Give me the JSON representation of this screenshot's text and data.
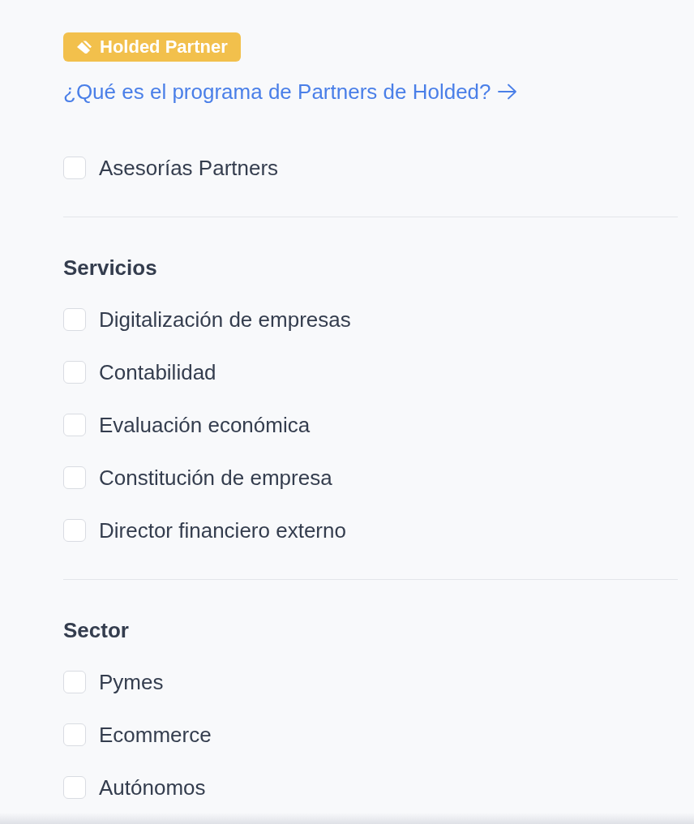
{
  "badge": {
    "label": "Holded Partner"
  },
  "link": {
    "label": "¿Qué es el programa de Partners de Holded?"
  },
  "partner_options": [
    {
      "label": "Asesorías Partners",
      "checked": false
    }
  ],
  "sections": [
    {
      "title": "Servicios",
      "options": [
        {
          "label": "Digitalización de empresas",
          "checked": false
        },
        {
          "label": "Contabilidad",
          "checked": false
        },
        {
          "label": "Evaluación económica",
          "checked": false
        },
        {
          "label": "Constitución de empresa",
          "checked": false
        },
        {
          "label": "Director financiero externo",
          "checked": false
        }
      ]
    },
    {
      "title": "Sector",
      "options": [
        {
          "label": "Pymes",
          "checked": false
        },
        {
          "label": "Ecommerce",
          "checked": false
        },
        {
          "label": "Autónomos",
          "checked": false
        }
      ]
    }
  ]
}
